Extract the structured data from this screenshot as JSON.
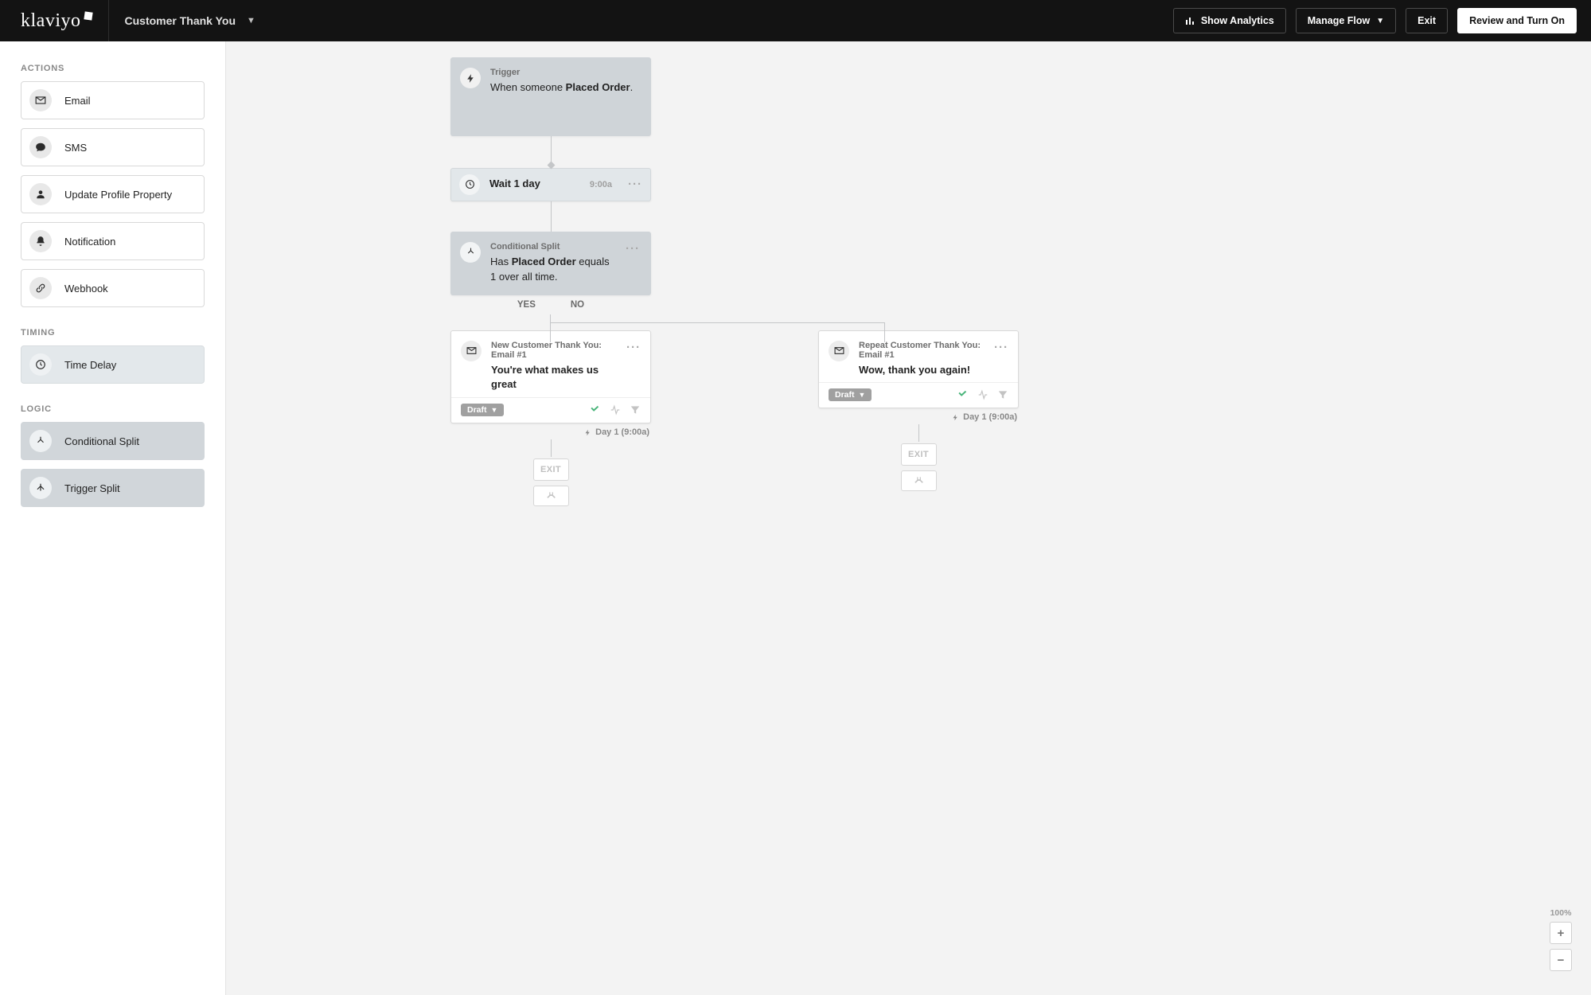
{
  "brand": "klaviyo",
  "header": {
    "flow_name": "Customer Thank You",
    "show_analytics": "Show Analytics",
    "manage_flow": "Manage Flow",
    "exit": "Exit",
    "review": "Review and Turn On"
  },
  "sidebar": {
    "actions_heading": "ACTIONS",
    "timing_heading": "TIMING",
    "logic_heading": "LOGIC",
    "actions": {
      "email": "Email",
      "sms": "SMS",
      "update": "Update Profile Property",
      "notification": "Notification",
      "webhook": "Webhook"
    },
    "timing": {
      "time_delay": "Time Delay"
    },
    "logic": {
      "conditional_split": "Conditional Split",
      "trigger_split": "Trigger Split"
    }
  },
  "flow": {
    "trigger": {
      "title": "Trigger",
      "pre": "When someone ",
      "bold": "Placed Order",
      "post": "."
    },
    "wait": {
      "label": "Wait 1 day",
      "time": "9:00a"
    },
    "split": {
      "title": "Conditional Split",
      "pre": "Has ",
      "bold": "Placed Order",
      "post": " equals 1 over all time."
    },
    "labels": {
      "yes": "YES",
      "no": "NO"
    },
    "email_a": {
      "title": "New Customer Thank You: Email #1",
      "subject": "You're what makes us great",
      "status": "Draft",
      "schedule": "Day 1 (9:00a)"
    },
    "email_b": {
      "title": "Repeat Customer Thank You: Email #1",
      "subject": "Wow, thank you again!",
      "status": "Draft",
      "schedule": "Day 1 (9:00a)"
    },
    "exit": "EXIT"
  },
  "zoom": {
    "value": "100%"
  }
}
